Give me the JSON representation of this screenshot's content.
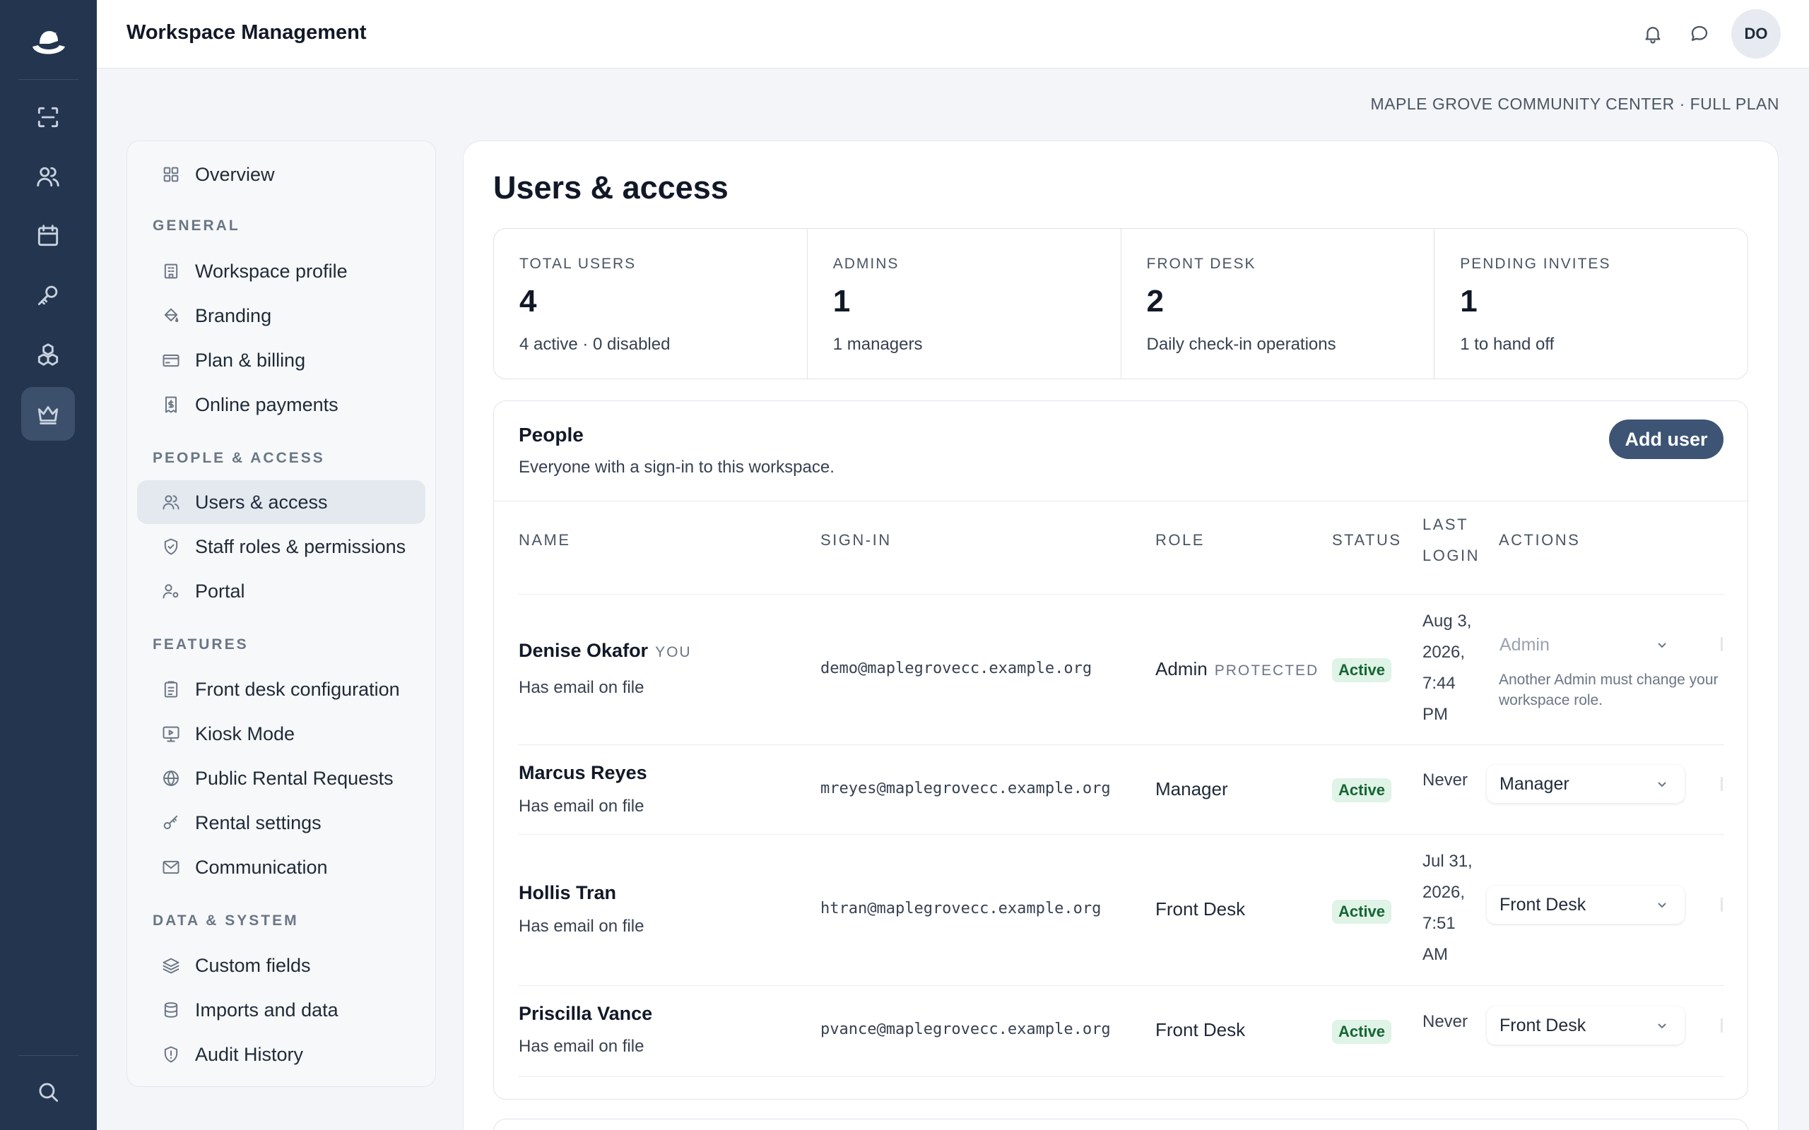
{
  "app": {
    "title": "Workspace Management",
    "avatar_initials": "DO",
    "org_line": "MAPLE GROVE COMMUNITY CENTER · FULL PLAN"
  },
  "rail": {
    "items": [
      "scan-icon",
      "people-icon",
      "calendar-icon",
      "key-icon",
      "cubes-icon",
      "crown-icon",
      "search-icon"
    ],
    "active": "crown-icon"
  },
  "nav": {
    "overview": "Overview",
    "sections": {
      "general": "GENERAL",
      "people": "PEOPLE & ACCESS",
      "features": "FEATURES",
      "data": "DATA & SYSTEM"
    },
    "items": {
      "workspace_profile": "Workspace profile",
      "branding": "Branding",
      "plan_billing": "Plan & billing",
      "online_payments": "Online payments",
      "users_access": "Users & access",
      "staff_roles": "Staff roles & permissions",
      "portal": "Portal",
      "front_desk_config": "Front desk configuration",
      "kiosk_mode": "Kiosk Mode",
      "public_rental": "Public Rental Requests",
      "rental_settings": "Rental settings",
      "communication": "Communication",
      "custom_fields": "Custom fields",
      "imports": "Imports and data",
      "audit": "Audit History"
    }
  },
  "page": {
    "title": "Users & access",
    "stats": [
      {
        "label": "TOTAL USERS",
        "value": "4",
        "sub": "4 active · 0 disabled"
      },
      {
        "label": "ADMINS",
        "value": "1",
        "sub": "1 managers"
      },
      {
        "label": "FRONT DESK",
        "value": "2",
        "sub": "Daily check-in operations"
      },
      {
        "label": "PENDING INVITES",
        "value": "1",
        "sub": "1 to hand off"
      }
    ],
    "people": {
      "title": "People",
      "subtitle": "Everyone with a sign-in to this workspace.",
      "add_button": "Add user",
      "columns": {
        "name": "NAME",
        "signin": "SIGN-IN",
        "role": "ROLE",
        "status": "STATUS",
        "last_login_1": "LAST",
        "last_login_2": "LOGIN",
        "actions": "ACTIONS"
      },
      "rows": [
        {
          "name": "Denise Okafor",
          "you": "YOU",
          "sub": "Has email on file",
          "email": "demo@maplegrovecc.example.org",
          "role": "Admin",
          "protected": "PROTECTED",
          "status": "Active",
          "login": [
            "Aug 3,",
            "2026,",
            "7:44",
            "PM"
          ],
          "select": "Admin",
          "note": [
            "Another Admin must change your",
            "workspace role."
          ]
        },
        {
          "name": "Marcus Reyes",
          "sub": "Has email on file",
          "email": "mreyes@maplegrovecc.example.org",
          "role": "Manager",
          "status": "Active",
          "login": [
            "Never"
          ],
          "select": "Manager"
        },
        {
          "name": "Hollis Tran",
          "sub": "Has email on file",
          "email": "htran@maplegrovecc.example.org",
          "role": "Front Desk",
          "status": "Active",
          "login": [
            "Jul 31,",
            "2026,",
            "7:51",
            "AM"
          ],
          "select": "Front Desk"
        },
        {
          "name": "Priscilla Vance",
          "sub": "Has email on file",
          "email": "pvance@maplegrovecc.example.org",
          "role": "Front Desk",
          "status": "Active",
          "login": [
            "Never"
          ],
          "select": "Front Desk"
        }
      ]
    }
  }
}
